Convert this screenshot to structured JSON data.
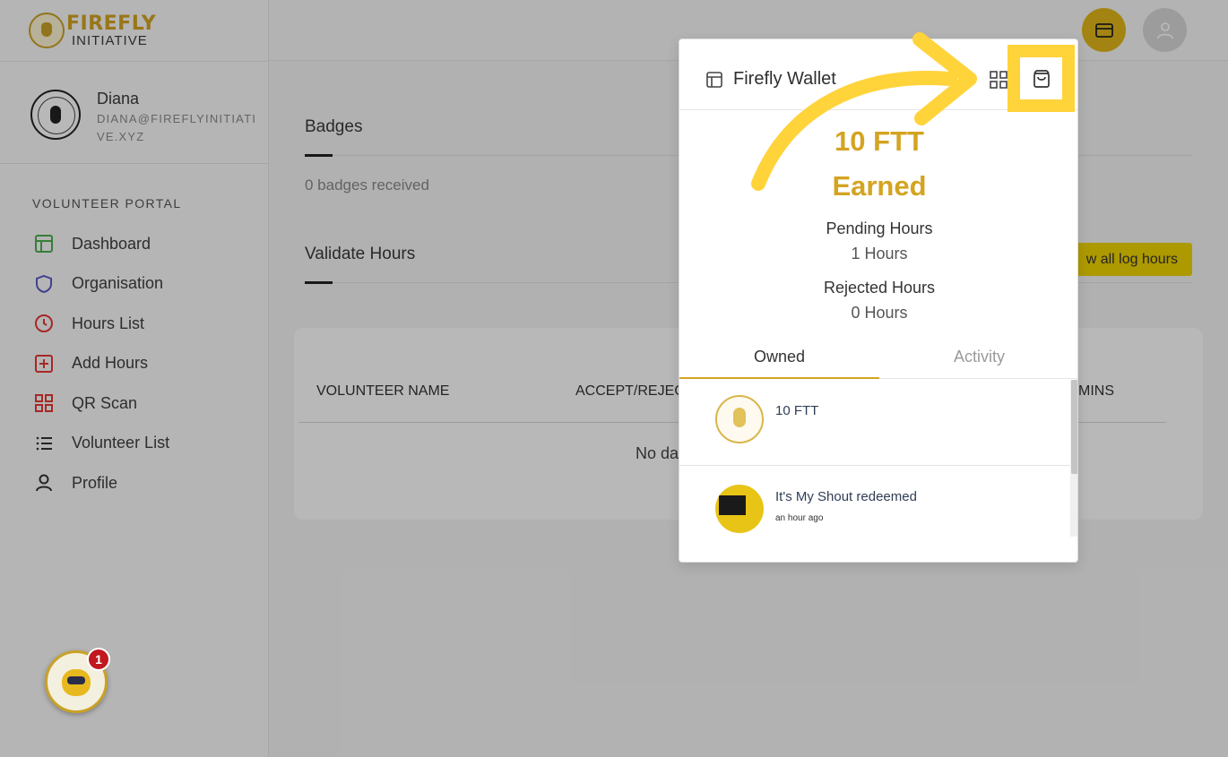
{
  "brand": {
    "line1": "FIREFLY",
    "line2": "INITIATIVE"
  },
  "user": {
    "name": "Diana",
    "email": "DIANA@FIREFLYINITIATIVE.XYZ"
  },
  "sidebar": {
    "section_title": "VOLUNTEER PORTAL",
    "items": [
      {
        "label": "Dashboard",
        "icon": "dashboard-icon",
        "color": "#4caf50"
      },
      {
        "label": "Organisation",
        "icon": "shield-icon",
        "color": "#5c5cc8"
      },
      {
        "label": "Hours List",
        "icon": "clock-icon",
        "color": "#e53935"
      },
      {
        "label": "Add Hours",
        "icon": "plus-square-icon",
        "color": "#e53935"
      },
      {
        "label": "QR Scan",
        "icon": "qr-grid-icon",
        "color": "#e53935"
      },
      {
        "label": "Volunteer List",
        "icon": "list-icon",
        "color": "#333333"
      },
      {
        "label": "Profile",
        "icon": "person-icon",
        "color": "#333333"
      }
    ]
  },
  "main": {
    "badges_title": "Badges",
    "badges_received": "0 badges received",
    "validate_title": "Validate Hours",
    "view_all_button": "w all log hours",
    "table": {
      "headers": [
        "VOLUNTEER NAME",
        "ACCEPT/REJEC",
        "MINS"
      ],
      "empty_text": "No da"
    }
  },
  "bot": {
    "notification_count": "1"
  },
  "wallet": {
    "title": "Firefly Wallet",
    "amount": "10 FTT",
    "earned_label": "Earned",
    "pending_label": "Pending Hours",
    "pending_value": "1 Hours",
    "rejected_label": "Rejected Hours",
    "rejected_value": "0 Hours",
    "tabs": [
      "Owned",
      "Activity"
    ],
    "items": [
      {
        "name": "10 FTT",
        "time": ""
      },
      {
        "name": "It's My Shout redeemed",
        "time": "an hour ago"
      }
    ],
    "accent": "#d4a421"
  },
  "annotation": {
    "highlight_color": "#ffd33a"
  }
}
